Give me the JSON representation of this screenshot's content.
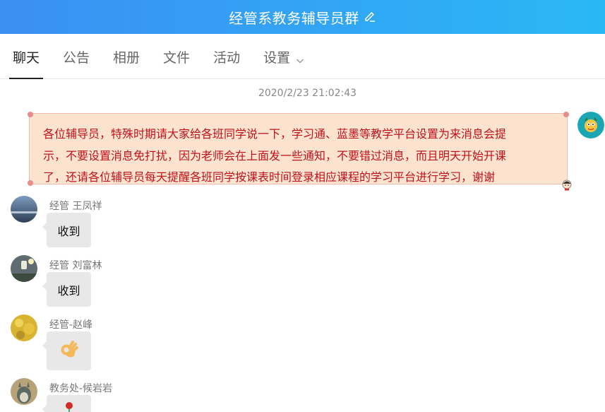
{
  "header": {
    "title": "经管系教务辅导员群",
    "edit_icon": "pencil-icon",
    "gradient": [
      "#3b8ff3",
      "#2ab8f5"
    ]
  },
  "tabs": [
    {
      "label": "聊天",
      "active": true
    },
    {
      "label": "公告",
      "active": false
    },
    {
      "label": "相册",
      "active": false
    },
    {
      "label": "文件",
      "active": false
    },
    {
      "label": "活动",
      "active": false
    },
    {
      "label": "设置",
      "active": false
    }
  ],
  "chat": {
    "timestamp": "2020/2/23 21:02:43",
    "notice": {
      "lines": [
        "各位辅导员，特殊时期请大家给各班同学说一下，学习通、蓝墨等教学平台设置为来消息会提",
        "示，不要设置消息免打扰，因为老师会在上面发一些通知，不要错过消息，而且明天开始开课",
        "了，还请各位辅导员每天提醒各班同学按课表时间登录相应课程的学习平台进行学习，谢谢"
      ],
      "text_color": "#c0121b",
      "background": "#fbe3d0"
    },
    "messages": [
      {
        "name": "经管 王凤祥",
        "content": "收到"
      },
      {
        "name": "经管 刘富林",
        "content": "收到"
      },
      {
        "name": "经管-赵峰",
        "content": "ok-hand-emoji"
      },
      {
        "name": "教务处-候岩岩",
        "content": "rose-emoji"
      }
    ]
  }
}
